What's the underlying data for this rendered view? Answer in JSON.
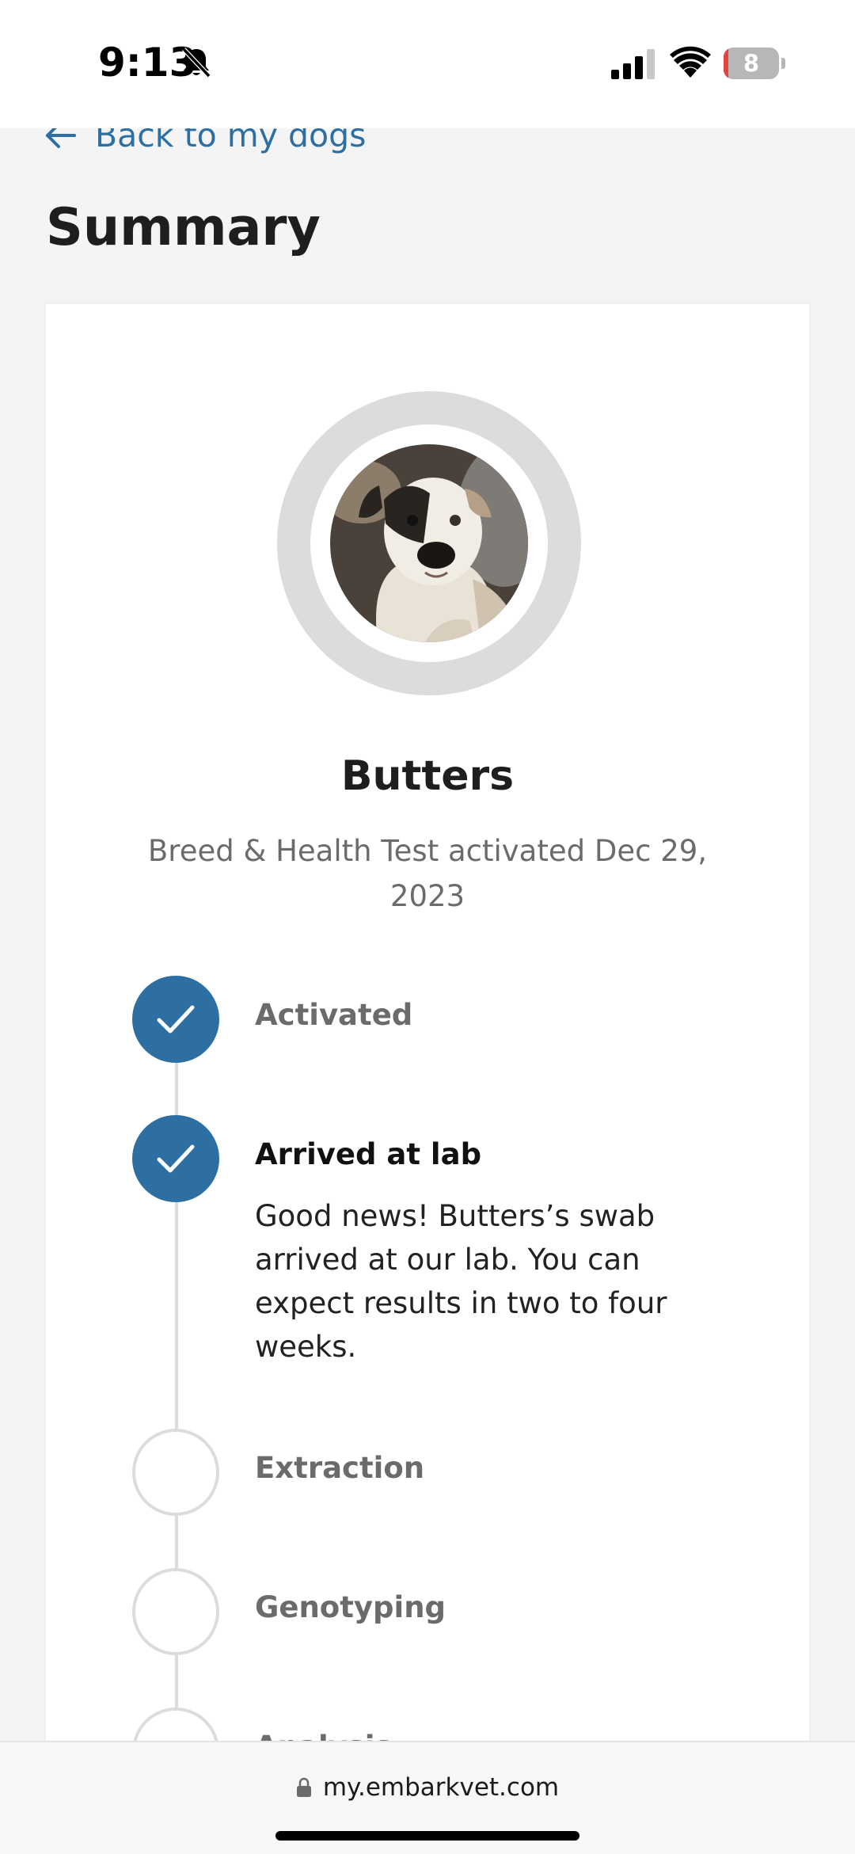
{
  "status_bar": {
    "time": "9:13",
    "battery_level": "8",
    "battery_fraction": 0.08,
    "signal_bars_active": 3,
    "colors": {
      "battery_low": "#e2453c",
      "battery_body": "#b7b7b7"
    }
  },
  "header": {
    "back_label": "Back to my dogs",
    "title": "Summary"
  },
  "dog": {
    "name": "Butters",
    "activation_text": "Breed & Health Test activated Dec 29, 2023"
  },
  "timeline": {
    "steps": [
      {
        "label": "Activated",
        "state": "done"
      },
      {
        "label": "Arrived at lab",
        "state": "done",
        "description": "Good news! Butters’s swab arrived at our lab. You can expect results in two to four weeks."
      },
      {
        "label": "Extraction",
        "state": "pending"
      },
      {
        "label": "Genotyping",
        "state": "pending"
      },
      {
        "label": "Analysis",
        "state": "pending"
      }
    ]
  },
  "browser": {
    "url": "my.embarkvet.com"
  },
  "colors": {
    "accent": "#2e6fa3",
    "pending_ring": "#dcdcdc",
    "background": "#f4f4f4",
    "card": "#ffffff"
  },
  "icons": {
    "back": "arrow-left-icon",
    "silent": "bell-slash-icon",
    "signal": "cellular-signal-icon",
    "wifi": "wifi-icon",
    "lock": "lock-icon",
    "check": "checkmark-icon"
  }
}
